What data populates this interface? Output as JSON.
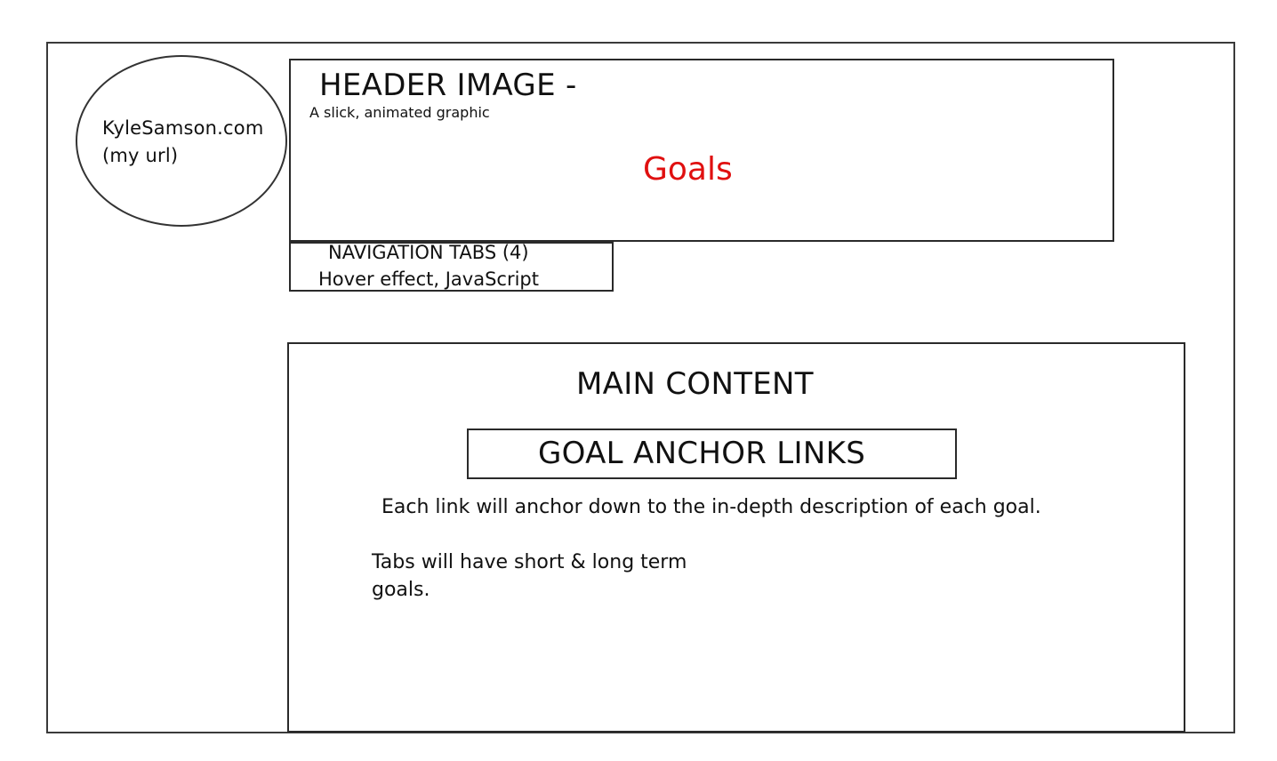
{
  "logo": {
    "line1": "KyleSamson.com",
    "line2": "(my url)"
  },
  "header": {
    "title": "HEADER IMAGE -",
    "subtitle": "A slick, animated graphic",
    "goals_label": "Goals",
    "goals_color": "#e01010"
  },
  "navigation": {
    "line1": "NAVIGATION TABS (4)",
    "line2": "Hover effect, JavaScript"
  },
  "main": {
    "title": "MAIN CONTENT",
    "anchor_links_label": "GOAL ANCHOR LINKS",
    "description_1": "Each link will anchor down to the in-depth description of each goal.",
    "description_2_line1": "Tabs will have short & long term",
    "description_2_line2": "goals."
  }
}
